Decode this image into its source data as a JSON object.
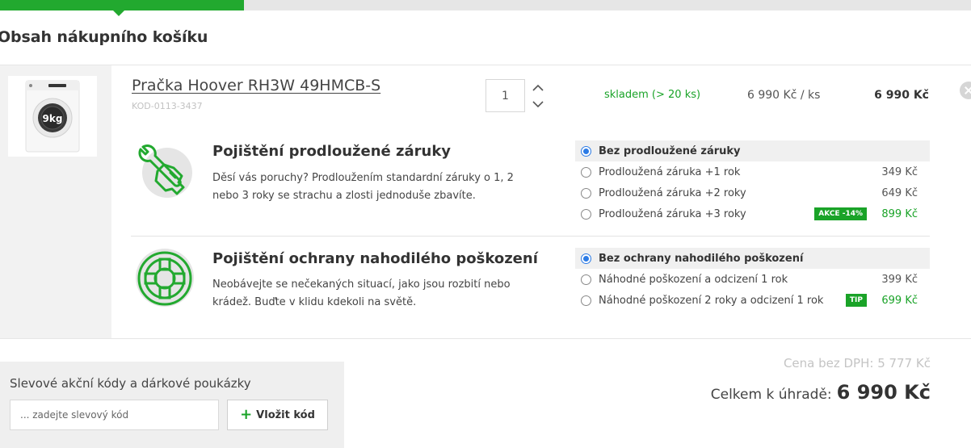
{
  "page_title": "Obsah nákupního košíku",
  "colors": {
    "accent_green": "#22a92f",
    "radio_blue": "#2c7be5",
    "badge_green": "#1aa328"
  },
  "checkout_progress": {
    "current_step_fill_fraction": 0.25
  },
  "product": {
    "name": "Pračka Hoover RH3W 49HMCB-S",
    "code": "KOD-0113-3437",
    "quantity": "1",
    "stock": "skladem (> 20 ks)",
    "unit_price": "6 990 Kč / ks",
    "line_total": "6 990 Kč",
    "image_label": "9kg",
    "image_icon": "washing-machine-image"
  },
  "warranty": {
    "icon": "wrench-hand-icon",
    "title": "Pojištění prodloužené záruky",
    "description": "Děsí vás poruchy? Prodloužením standardní záruky o 1, 2 nebo 3 roky se strachu a zlosti jednoduše zbavíte.",
    "options": [
      {
        "label": "Bez prodloužené záruky",
        "price": "",
        "badge": "",
        "selected": true
      },
      {
        "label": "Prodloužená záruka +1 rok",
        "price": "349 Kč",
        "badge": "",
        "selected": false
      },
      {
        "label": "Prodloužená záruka +2 roky",
        "price": "649 Kč",
        "badge": "",
        "selected": false
      },
      {
        "label": "Prodloužená záruka +3 roky",
        "price": "899 Kč",
        "badge": "AKCE -14%",
        "selected": false
      }
    ]
  },
  "damage": {
    "icon": "lifebuoy-icon",
    "title": "Pojištění ochrany nahodilého poškození",
    "description": "Neobávejte se nečekaných situací, jako jsou rozbití nebo krádež. Buďte v klidu kdekoli na světě.",
    "options": [
      {
        "label": "Bez ochrany nahodilého poškození",
        "price": "",
        "badge": "",
        "selected": true
      },
      {
        "label": "Náhodné poškození a odcizení 1 rok",
        "price": "399 Kč",
        "badge": "",
        "selected": false
      },
      {
        "label": "Náhodné poškození 2 roky a odcizení 1 rok",
        "price": "699 Kč",
        "badge": "TIP",
        "selected": false
      }
    ]
  },
  "promo": {
    "title": "Slevové akční kódy a dárkové poukázky",
    "placeholder": "... zadejte slevový kód",
    "button_label": "Vložit kód"
  },
  "summary": {
    "without_vat": "Cena bez DPH: 5 777 Kč",
    "total_label": "Celkem k úhradě:",
    "total_amount": "6 990 Kč"
  }
}
